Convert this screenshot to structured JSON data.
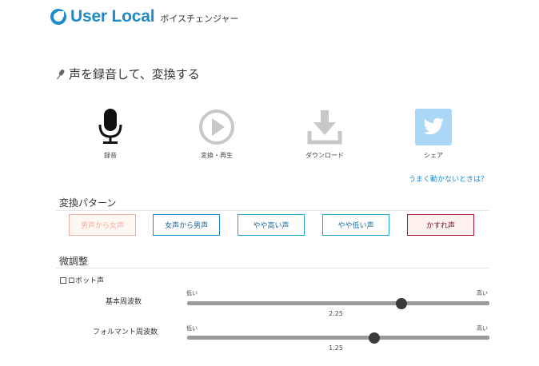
{
  "header": {
    "brand": "User Local",
    "subtitle": "ボイスチェンジャー"
  },
  "title": "声を録音して、変換する",
  "actions": [
    {
      "label": "録音",
      "icon": "microphone-icon"
    },
    {
      "label": "変換・再生",
      "icon": "play-icon"
    },
    {
      "label": "ダウンロード",
      "icon": "download-icon"
    },
    {
      "label": "シェア",
      "icon": "twitter-icon"
    }
  ],
  "help_link": "うまく動かないときは？",
  "patterns": {
    "title": "変換パターン",
    "buttons": [
      {
        "label": "男声から女声",
        "color": "#f2b0a0",
        "state": "disabled"
      },
      {
        "label": "女声から男声",
        "color": "#1d8bc9"
      },
      {
        "label": "やや高い声",
        "color": "#1da6c9"
      },
      {
        "label": "やや低い声",
        "color": "#1da6c9"
      },
      {
        "label": "かすれ声",
        "color": "#a01638",
        "bg": "#fdf1ec"
      }
    ]
  },
  "fine_tune": {
    "title": "微調整",
    "robot_label": "ロボット声",
    "robot_checked": false,
    "sliders": [
      {
        "label": "基本周波数",
        "low": "低い",
        "high": "高い",
        "value": "2.25",
        "fraction": 0.71
      },
      {
        "label": "フォルマント周波数",
        "low": "低い",
        "high": "高い",
        "value": "1.25",
        "fraction": 0.62
      }
    ]
  }
}
